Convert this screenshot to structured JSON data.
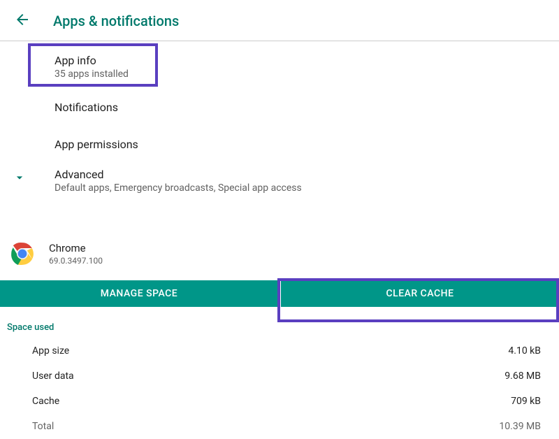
{
  "header": {
    "title": "Apps & notifications"
  },
  "menu": {
    "app_info": {
      "title": "App info",
      "sub": "35 apps installed"
    },
    "notifications": {
      "title": "Notifications"
    },
    "permissions": {
      "title": "App permissions"
    },
    "advanced": {
      "title": "Advanced",
      "sub": "Default apps, Emergency broadcasts, Special app access"
    }
  },
  "app": {
    "name": "Chrome",
    "version": "69.0.3497.100"
  },
  "buttons": {
    "manage_space": "MANAGE SPACE",
    "clear_cache": "CLEAR CACHE"
  },
  "space": {
    "header": "Space used",
    "rows": [
      {
        "label": "App size",
        "value": "4.10 kB"
      },
      {
        "label": "User data",
        "value": "9.68 MB"
      },
      {
        "label": "Cache",
        "value": "709 kB"
      },
      {
        "label": "Total",
        "value": "10.39 MB"
      }
    ]
  }
}
